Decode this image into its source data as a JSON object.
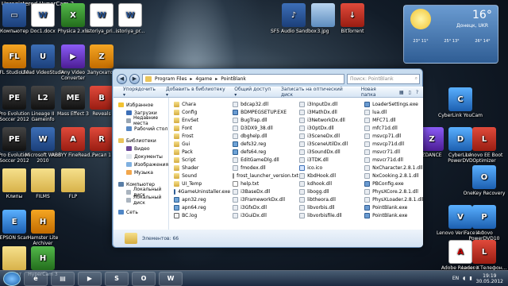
{
  "watermark": "Unregistered HyperCam 3",
  "desktop": {
    "icons": [
      {
        "label": "Компьютер",
        "kind": "app",
        "glyph": "▭"
      },
      {
        "label": "Doc1.docx",
        "kind": "word",
        "glyph": "W"
      },
      {
        "label": "Physica 2.xls",
        "kind": "green",
        "glyph": "X"
      },
      {
        "label": "istoriya_pri...",
        "kind": "word",
        "glyph": "W"
      },
      {
        "label": "istoriya_pr...",
        "kind": "word",
        "glyph": "W"
      },
      {
        "label": "SF5 Audio Sandbox",
        "kind": "app",
        "glyph": "♪"
      },
      {
        "label": "3.jpg",
        "kind": "img",
        "glyph": ""
      },
      {
        "label": "BitTorrent",
        "kind": "red",
        "glyph": "↓"
      },
      {
        "label": "FL Studio 10",
        "kind": "orange",
        "glyph": "FL"
      },
      {
        "label": "Ulead VideoStudio",
        "kind": "app",
        "glyph": "U"
      },
      {
        "label": "Any Video Converter",
        "kind": "purple",
        "glyph": "▶"
      },
      {
        "label": "Запускатор",
        "kind": "orange",
        "glyph": "Z"
      },
      {
        "label": "Pro Evolution Soccer 2012",
        "kind": "dark",
        "glyph": "PE"
      },
      {
        "label": "Lineage II Gameinfo",
        "kind": "dark",
        "glyph": "L2"
      },
      {
        "label": "Mass Effect 3",
        "kind": "dark",
        "glyph": "ME"
      },
      {
        "label": "Reveals",
        "kind": "red",
        "glyph": "B"
      },
      {
        "label": "Pro Evolution Soccer 2012",
        "kind": "dark",
        "glyph": "PE"
      },
      {
        "label": "Microsoft Word 2010",
        "kind": "app",
        "glyph": "W"
      },
      {
        "label": "ABBYY FineRead...",
        "kind": "red",
        "glyph": "A"
      },
      {
        "label": "Рисал 1",
        "kind": "red",
        "glyph": "R"
      },
      {
        "label": "Клипы",
        "kind": "folder",
        "glyph": ""
      },
      {
        "label": "FILMS",
        "kind": "folder",
        "glyph": ""
      },
      {
        "label": "FLP",
        "kind": "folder",
        "glyph": ""
      },
      {
        "label": "EPSON Scan",
        "kind": "blue",
        "glyph": "E"
      },
      {
        "label": "Hamster Lite Archiver",
        "kind": "orange",
        "glyph": "H"
      },
      {
        "label": "пакет",
        "kind": "folder",
        "glyph": ""
      },
      {
        "label": "HyperCam 3",
        "kind": "green",
        "glyph": "H"
      },
      {
        "label": "CyberLink YouCam",
        "kind": "blue",
        "glyph": "C"
      },
      {
        "label": "CyberLink PowerDVD",
        "kind": "blue",
        "glyph": "D"
      },
      {
        "label": "ZDANCE",
        "kind": "purple",
        "glyph": "Z"
      },
      {
        "label": "Lenovo EE Boot Optimizer",
        "kind": "red",
        "glyph": "L"
      },
      {
        "label": "OneKey Recovery",
        "kind": "blue",
        "glyph": "O"
      },
      {
        "label": "Lenovo PowerDVD10",
        "kind": "blue",
        "glyph": "P"
      },
      {
        "label": "Lenovo VeriFace 4.0",
        "kind": "blue",
        "glyph": "V"
      },
      {
        "label": "Lenovo Телефон...",
        "kind": "red",
        "glyph": "L"
      },
      {
        "label": "Adobe Reader X",
        "kind": "pdf",
        "glyph": "A"
      }
    ]
  },
  "weather": {
    "temp": "16°",
    "city": "Донецк, UKR",
    "forecast": [
      "23° 11°",
      "25° 13°",
      "26° 14°"
    ]
  },
  "explorer": {
    "address": [
      "Program Files",
      "4game",
      "PointBlank"
    ],
    "search_placeholder": "Поиск: PointBlank",
    "toolbar": [
      "Упорядочить ▾",
      "Добавить в библиотеку ▾",
      "Общий доступ ▾",
      "Записать на оптический диск",
      "Новая папка"
    ],
    "nav": {
      "favorites": "Избранное",
      "favorites_items": [
        "Загрузки",
        "Недавние места",
        "Рабочий стол"
      ],
      "libraries": "Библиотеки",
      "libraries_items": [
        "Видео",
        "Документы",
        "Изображения",
        "Музыка"
      ],
      "computer": "Компьютер",
      "computer_items": [
        "Локальный диск",
        "Локальный диск"
      ],
      "network": "Сеть"
    },
    "columns": [
      [
        {
          "name": "Chara",
          "t": "folder"
        },
        {
          "name": "Config",
          "t": "folder"
        },
        {
          "name": "EnvSet",
          "t": "folder"
        },
        {
          "name": "Font",
          "t": "folder"
        },
        {
          "name": "Frost",
          "t": "folder"
        },
        {
          "name": "Gui",
          "t": "folder"
        },
        {
          "name": "Pack",
          "t": "folder"
        },
        {
          "name": "Script",
          "t": "folder"
        },
        {
          "name": "Shader",
          "t": "folder"
        },
        {
          "name": "Sound",
          "t": "folder"
        },
        {
          "name": "UI_Temp",
          "t": "folder"
        },
        {
          "name": "4GameUninstaller.exe",
          "t": "exe"
        },
        {
          "name": "apn32.reg",
          "t": "reg"
        },
        {
          "name": "apn64.reg",
          "t": "reg"
        },
        {
          "name": "BC.log",
          "t": "log"
        }
      ],
      [
        {
          "name": "bdcap32.dll",
          "t": "dll"
        },
        {
          "name": "BDMPEGSETUP.EXE",
          "t": "exe"
        },
        {
          "name": "BugTrap.dll",
          "t": "dll"
        },
        {
          "name": "D3DX9_38.dll",
          "t": "dll"
        },
        {
          "name": "dbghelp.dll",
          "t": "dll"
        },
        {
          "name": "defs32.reg",
          "t": "reg"
        },
        {
          "name": "defs64.reg",
          "t": "reg"
        },
        {
          "name": "EditGameDlg.dll",
          "t": "dll"
        },
        {
          "name": "fmodex.dll",
          "t": "dll"
        },
        {
          "name": "frost_launcher_version.txt",
          "t": "txt"
        },
        {
          "name": "help.txt",
          "t": "txt"
        },
        {
          "name": "i3BaseDx.dll",
          "t": "dll"
        },
        {
          "name": "i3FrameworkDx.dll",
          "t": "dll"
        },
        {
          "name": "i3GfxDx.dll",
          "t": "dll"
        },
        {
          "name": "i3GuiDx.dll",
          "t": "dll"
        }
      ],
      [
        {
          "name": "i3InputDx.dll",
          "t": "dll"
        },
        {
          "name": "i3MathDx.dll",
          "t": "dll"
        },
        {
          "name": "i3NetworkDx.dll",
          "t": "dll"
        },
        {
          "name": "i3OptDx.dll",
          "t": "dll"
        },
        {
          "name": "i3SceneDx.dll",
          "t": "dll"
        },
        {
          "name": "i3SceneUtilDx.dll",
          "t": "dll"
        },
        {
          "name": "i3SoundDx.dll",
          "t": "dll"
        },
        {
          "name": "i3TDK.dll",
          "t": "dll"
        },
        {
          "name": "ico.ico",
          "t": "ico"
        },
        {
          "name": "KbdHook.dll",
          "t": "dll"
        },
        {
          "name": "kdhook.dll",
          "t": "dll"
        },
        {
          "name": "libogg.dll",
          "t": "dll"
        },
        {
          "name": "libtheora.dll",
          "t": "dll"
        },
        {
          "name": "libvorbis.dll",
          "t": "dll"
        },
        {
          "name": "libvorbisfile.dll",
          "t": "dll"
        }
      ],
      [
        {
          "name": "LoaderSettings.exe",
          "t": "exe"
        },
        {
          "name": "lua.dll",
          "t": "dll"
        },
        {
          "name": "MFC71.dll",
          "t": "dll"
        },
        {
          "name": "mfc71d.dll",
          "t": "dll"
        },
        {
          "name": "msvcp71.dll",
          "t": "dll"
        },
        {
          "name": "msvcp71d.dll",
          "t": "dll"
        },
        {
          "name": "msvcr71.dll",
          "t": "dll"
        },
        {
          "name": "msvcr71d.dll",
          "t": "dll"
        },
        {
          "name": "NxCharacter.2.8.1.dll",
          "t": "dll"
        },
        {
          "name": "NxCooking.2.8.1.dll",
          "t": "dll"
        },
        {
          "name": "PBConfig.exe",
          "t": "exe"
        },
        {
          "name": "PhysXCore.2.8.1.dll",
          "t": "dll"
        },
        {
          "name": "PhysXLoader.2.8.1.dll",
          "t": "dll"
        },
        {
          "name": "PointBlank.exe",
          "t": "exe"
        },
        {
          "name": "PointBlank.exe",
          "t": "exe"
        }
      ]
    ],
    "status": "Элементов: 66"
  },
  "taskbar": {
    "items": [
      "e",
      "▤",
      "▶",
      "S",
      "O",
      "W"
    ],
    "lang": "EN",
    "time": "19:19",
    "date": "30.05.2012"
  }
}
